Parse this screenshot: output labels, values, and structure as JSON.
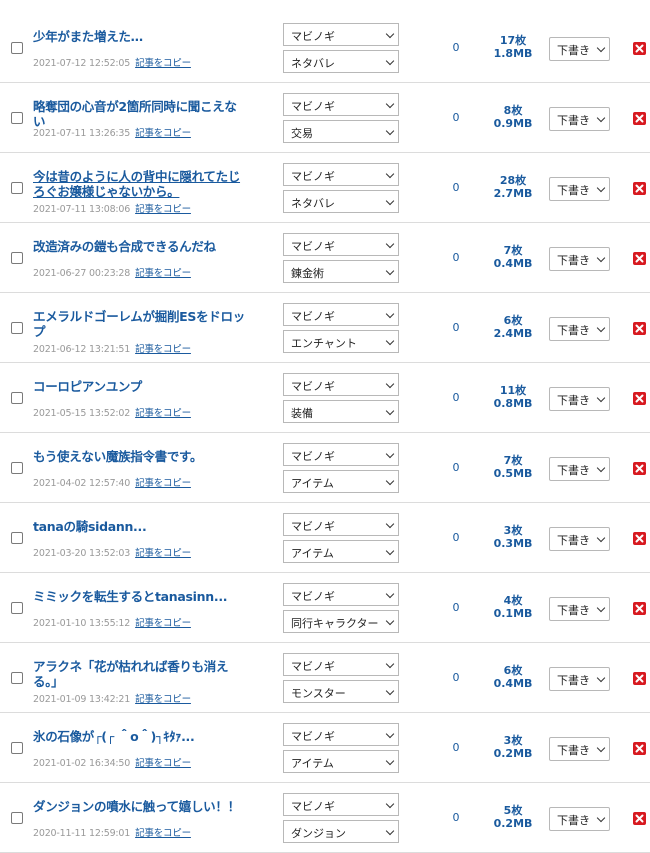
{
  "articles": [
    {
      "title": "少年がまた増えた…",
      "date": "2021-07-12 12:52:05",
      "category": "マビノギ",
      "tag": "ネタバレ",
      "comments": "0",
      "images": "17枚",
      "size": "1.8MB",
      "status": "下書き"
    },
    {
      "title": "略奪団の心音が2箇所同時に聞こえない",
      "date": "2021-07-11 13:26:35",
      "category": "マビノギ",
      "tag": "交易",
      "comments": "0",
      "images": "8枚",
      "size": "0.9MB",
      "status": "下書き"
    },
    {
      "title": "今は昔のように人の背中に隠れてたじろぐお嬢様じゃないから。",
      "date": "2021-07-11 13:08:06",
      "category": "マビノギ",
      "tag": "ネタバレ",
      "comments": "0",
      "images": "28枚",
      "size": "2.7MB",
      "status": "下書き"
    },
    {
      "title": "改造済みの鎧も合成できるんだね",
      "date": "2021-06-27 00:23:28",
      "category": "マビノギ",
      "tag": "錬金術",
      "comments": "0",
      "images": "7枚",
      "size": "0.4MB",
      "status": "下書き"
    },
    {
      "title": "エメラルドゴーレムが掘削ESをドロップ",
      "date": "2021-06-12 13:21:51",
      "category": "マビノギ",
      "tag": "エンチャント",
      "comments": "0",
      "images": "6枚",
      "size": "2.4MB",
      "status": "下書き"
    },
    {
      "title": "コーロピアンユンプ",
      "date": "2021-05-15 13:52:02",
      "category": "マビノギ",
      "tag": "装備",
      "comments": "0",
      "images": "11枚",
      "size": "0.8MB",
      "status": "下書き"
    },
    {
      "title": "もう使えない魔族指令書です。",
      "date": "2021-04-02 12:57:40",
      "category": "マビノギ",
      "tag": "アイテム",
      "comments": "0",
      "images": "7枚",
      "size": "0.5MB",
      "status": "下書き"
    },
    {
      "title": "tanaの騎sidann...",
      "date": "2021-03-20 13:52:03",
      "category": "マビノギ",
      "tag": "アイテム",
      "comments": "0",
      "images": "3枚",
      "size": "0.3MB",
      "status": "下書き"
    },
    {
      "title": "ミミックを転生するとtanasinn...",
      "date": "2021-01-10 13:55:12",
      "category": "マビノギ",
      "tag": "同行キャラクター",
      "comments": "0",
      "images": "4枚",
      "size": "0.1MB",
      "status": "下書き"
    },
    {
      "title": "アラクネ「花が枯れれば香りも消える。」",
      "date": "2021-01-09 13:42:21",
      "category": "マビノギ",
      "tag": "モンスター",
      "comments": "0",
      "images": "6枚",
      "size": "0.4MB",
      "status": "下書き"
    },
    {
      "title": "氷の石像が┌(┌ ＾o＾)┐ｷﾀｧ...",
      "date": "2021-01-02 16:34:50",
      "category": "マビノギ",
      "tag": "アイテム",
      "comments": "0",
      "images": "3枚",
      "size": "0.2MB",
      "status": "下書き"
    },
    {
      "title": "ダンジョンの噴水に触って嬉しい！！",
      "date": "2020-11-11 12:59:01",
      "category": "マビノギ",
      "tag": "ダンジョン",
      "comments": "0",
      "images": "5枚",
      "size": "0.2MB",
      "status": "下書き"
    }
  ],
  "copy_label": "記事をコピー"
}
